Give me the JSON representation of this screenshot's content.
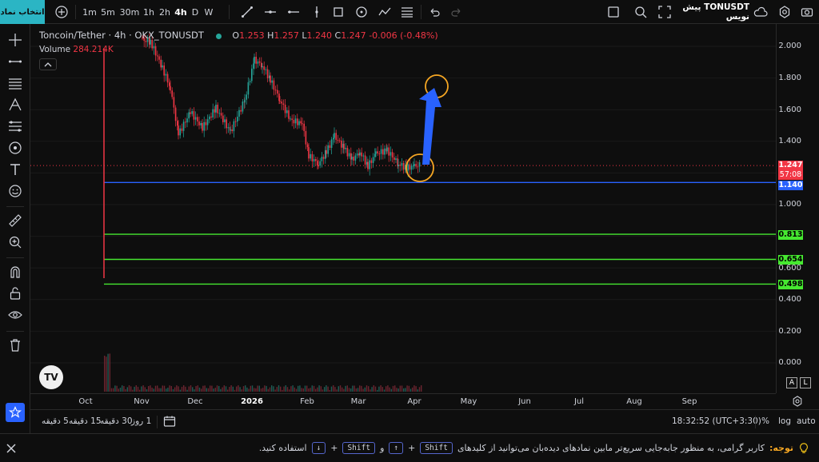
{
  "toolbar": {
    "symbol_button": "انتخاب نماد",
    "timeframes": [
      "1m",
      "5m",
      "30m",
      "1h",
      "2h",
      "4h",
      "D",
      "W"
    ],
    "active_timeframe": "4h",
    "symbol_label": "TONUSDT پیش نویس"
  },
  "legend": {
    "symbol": "Toncoin/Tether · 4h · OKX_TONUSDT",
    "o_key": "O",
    "o_val": "1.253",
    "h_key": "H",
    "h_val": "1.257",
    "l_key": "L",
    "l_val": "1.240",
    "c_key": "C",
    "c_val": "1.247",
    "change": "-0.006 (-0.48%)",
    "volume_key": "Volume",
    "volume_val": "284.214K"
  },
  "price_axis": {
    "labels": [
      "2.000",
      "1.800",
      "1.600",
      "1.400",
      "1.000",
      "0.600",
      "0.400",
      "0.200",
      "0.000"
    ],
    "current_price": "1.247",
    "countdown": "57:08",
    "blue_line": "1.140",
    "green_lines": [
      "0.813",
      "0.654",
      "0.498"
    ]
  },
  "time_axis": {
    "labels": [
      "Oct",
      "Nov",
      "Dec",
      "2026",
      "Feb",
      "Mar",
      "Apr",
      "May",
      "Jun",
      "Jul",
      "Aug",
      "Sep"
    ]
  },
  "axis_buttons": {
    "a": "A",
    "l": "L"
  },
  "bottom": {
    "ranges": [
      "5 دقیقه",
      "15 دقیقه",
      "30 دقیقه",
      "1 روز"
    ],
    "time": "18:32:52 (UTC+3:30)",
    "percent": "%",
    "log": "log",
    "auto": "auto"
  },
  "notice": {
    "label": "توجه:",
    "text": "کاربر گرامی، به منظور جابه‌جایی سریع‌تر مابین نمادهای دیده‌بان می‌توانید از کلیدهای",
    "key1": "Shift",
    "plus1": "+",
    "arrow_up": "↑",
    "and": "و",
    "key2": "Shift",
    "plus2": "+",
    "arrow_down": "↓",
    "end": "استفاده کنید."
  },
  "chart_data": {
    "type": "candlestick",
    "x": [
      "Oct",
      "Nov",
      "Dec",
      "2026",
      "Feb",
      "Mar",
      "Apr"
    ],
    "close_approx": [
      1.95,
      2.05,
      1.5,
      1.85,
      1.45,
      1.3,
      1.247
    ],
    "ylim": [
      0,
      2.1
    ],
    "horizontal_lines": [
      {
        "value": 1.14,
        "color": "#2962ff"
      },
      {
        "value": 0.813,
        "color": "#4caf50"
      },
      {
        "value": 0.654,
        "color": "#4caf50"
      },
      {
        "value": 0.498,
        "color": "#4caf50"
      }
    ]
  },
  "colors": {
    "accent": "#2bb5c4",
    "up": "#26a69a",
    "down": "#f23645",
    "blue_line": "#2962ff",
    "green_line": "#46e830",
    "annotation": "#f5a623",
    "arrow": "#2962ff"
  }
}
